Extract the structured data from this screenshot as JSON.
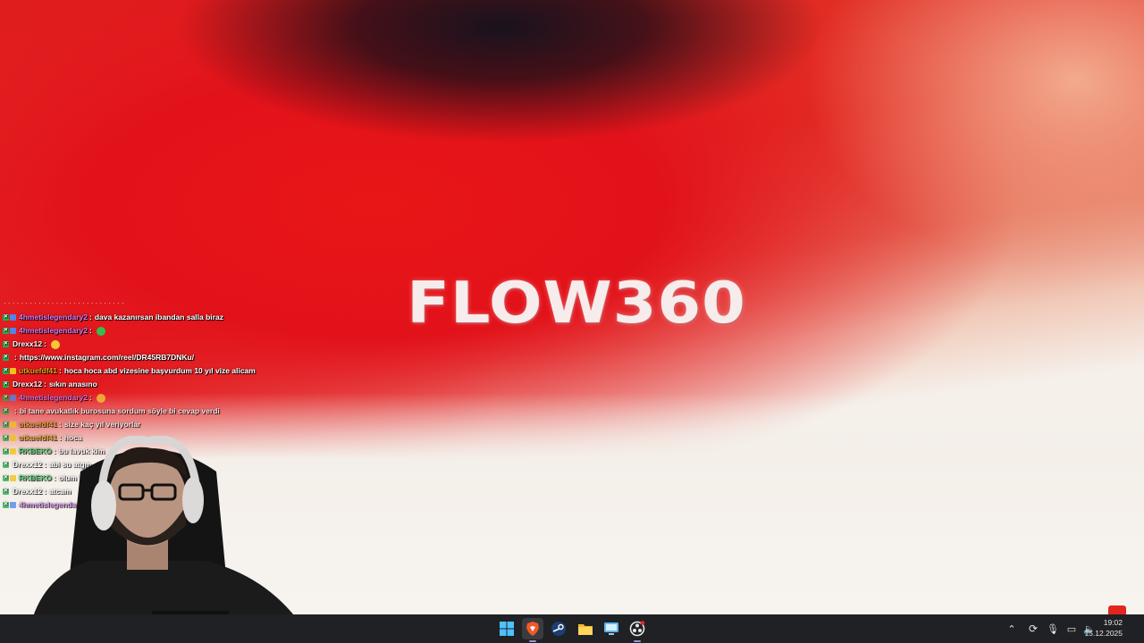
{
  "wallpaper": {
    "logo_text": "FLOW360"
  },
  "chat": {
    "messages": [
      {
        "user": "4hmetislegendary2",
        "user_color": "#d77cf3",
        "badge": "#4f86e8",
        "text": "dava kazanırsan ibandan salla biraz",
        "emote": ""
      },
      {
        "user": "4hmetislegendary2",
        "user_color": "#d77cf3",
        "badge": "#4f86e8",
        "text": "",
        "emote": "green"
      },
      {
        "user": "Drexx12",
        "user_color": "#ffffff",
        "badge": "",
        "text": "",
        "emote": "yellow"
      },
      {
        "user": "",
        "user_color": "#c2271f",
        "badge": "",
        "text": "https://www.instagram.com/reel/DR45RB7DNKu/",
        "emote": ""
      },
      {
        "user": "utkuefdf41",
        "user_color": "#e6a21d",
        "badge": "#f1c21a",
        "text": "hoca hoca abd vizesine başvurdum 10 yıl vize alicam",
        "emote": ""
      },
      {
        "user": "Drexx12",
        "user_color": "#ffffff",
        "badge": "",
        "text": "sıkın anasıno",
        "emote": ""
      },
      {
        "user": "4hmetislegendary2",
        "user_color": "#d77cf3",
        "badge": "#4f86e8",
        "text": "",
        "emote": "yellow"
      },
      {
        "user": "",
        "user_color": "#a58ce0",
        "badge": "",
        "text": "bi tane avukatlık burosuna sordum söyle bi cevap verdi",
        "emote": ""
      },
      {
        "user": "utkuefdf41",
        "user_color": "#e6a21d",
        "badge": "#f1c21a",
        "text": "size kaç yıl veriyorlar",
        "emote": ""
      },
      {
        "user": "utkuefdf41",
        "user_color": "#e6a21d",
        "badge": "#f1c21a",
        "text": "hoca",
        "emote": ""
      },
      {
        "user": "RKBEKO",
        "user_color": "#37c45a",
        "badge": "#f1c21a",
        "text": "bu lavuk kim",
        "emote": ""
      },
      {
        "user": "Drexx12",
        "user_color": "#ffffff",
        "badge": "",
        "text": "abi su atgm",
        "emote": ""
      },
      {
        "user": "RKBEKO",
        "user_color": "#37c45a",
        "badge": "#f1c21a",
        "text": "olum *****",
        "emote": ""
      },
      {
        "user": "Drexx12",
        "user_color": "#ffffff",
        "badge": "",
        "text": "atcam",
        "emote": ""
      },
      {
        "user": "4hmetislegendary2",
        "user_color": "#d77cf3",
        "badge": "#4f86e8",
        "text": "",
        "emote": ""
      }
    ]
  },
  "taskbar": {
    "apps": [
      {
        "name": "start-icon",
        "color": "#3aa0f3",
        "active": false
      },
      {
        "name": "brave-browser-icon",
        "color": "#f05a28",
        "active": true
      },
      {
        "name": "steam-icon",
        "color": "#1b4b8a",
        "active": false
      },
      {
        "name": "file-explorer-icon",
        "color": "#f3c13a",
        "active": false
      },
      {
        "name": "remote-desktop-icon",
        "color": "#4aa4e8",
        "active": false
      },
      {
        "name": "obs-icon",
        "color": "#d8d8d8",
        "active": true
      }
    ],
    "tray": {
      "time": "19:02",
      "date": "15.12.2025"
    }
  }
}
